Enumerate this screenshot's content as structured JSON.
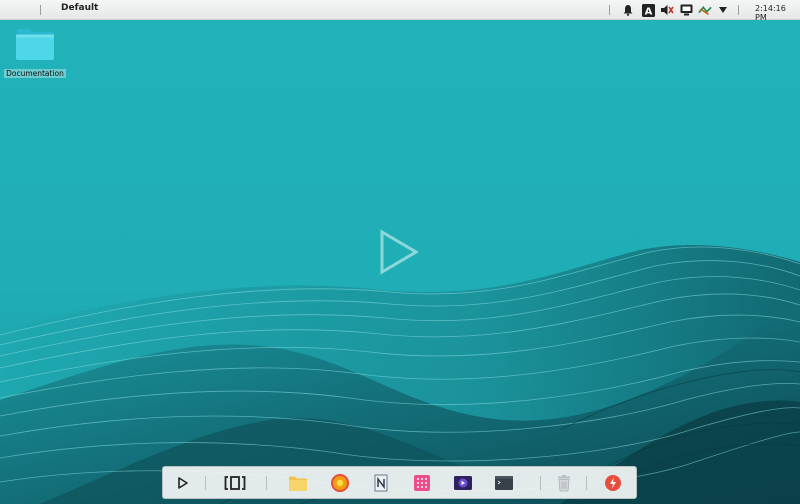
{
  "topbar": {
    "workspace": "Default",
    "clock": "2:14:16 PM",
    "tray_icons": [
      "notification-bell-icon",
      "keyboard-layout-icon",
      "volume-muted-icon",
      "display-icon",
      "network-icon",
      "dropdown-arrow-icon"
    ],
    "keyboard_letter": "A"
  },
  "desktop": {
    "icons": [
      {
        "label": "Documentation",
        "icon": "folder-icon"
      }
    ],
    "center_logo": "play-logo-icon"
  },
  "dock": {
    "items": [
      {
        "name": "launcher-icon"
      },
      {
        "name": "multitasking-view-icon"
      },
      {
        "name": "file-manager-icon"
      },
      {
        "name": "browser-icon"
      },
      {
        "name": "text-editor-icon"
      },
      {
        "name": "app-store-icon"
      },
      {
        "name": "video-player-icon"
      },
      {
        "name": "terminal-icon"
      },
      {
        "name": "trash-icon"
      },
      {
        "name": "power-icon"
      }
    ]
  },
  "colors": {
    "desktop_bg": "#21b1b9",
    "wave_dark": "#0e4f58",
    "wave_mid": "#178e97"
  }
}
